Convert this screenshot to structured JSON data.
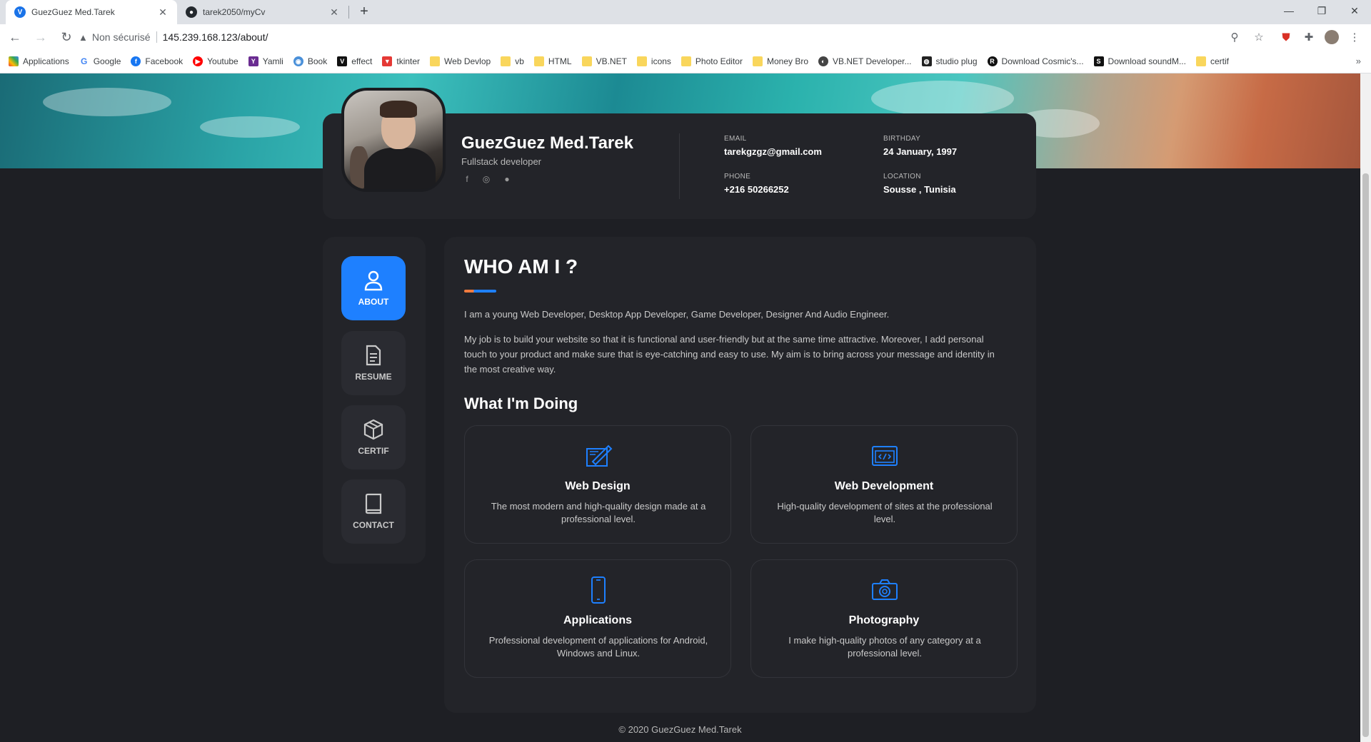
{
  "browser": {
    "tabs": [
      {
        "title": "GuezGuez Med.Tarek",
        "favicon": "V"
      },
      {
        "title": "tarek2050/myCv",
        "favicon": "github-icon"
      }
    ],
    "new_tab": "+",
    "security": "Non sécurisé",
    "url": "145.239.168.123/about/",
    "bookmarks": [
      {
        "label": "Applications",
        "icon": "apps-grid-icon"
      },
      {
        "label": "Google",
        "icon": "google-icon"
      },
      {
        "label": "Facebook",
        "icon": "facebook-icon"
      },
      {
        "label": "Youtube",
        "icon": "youtube-icon"
      },
      {
        "label": "Yamli",
        "icon": "yamli-icon"
      },
      {
        "label": "Book",
        "icon": "globe-icon"
      },
      {
        "label": "effect",
        "icon": "v-icon"
      },
      {
        "label": "tkinter",
        "icon": "vue-icon"
      },
      {
        "label": "Web Devlop",
        "icon": "folder-icon"
      },
      {
        "label": "vb",
        "icon": "folder-icon"
      },
      {
        "label": "HTML",
        "icon": "folder-icon"
      },
      {
        "label": "VB.NET",
        "icon": "folder-icon"
      },
      {
        "label": "icons",
        "icon": "folder-icon"
      },
      {
        "label": "Photo Editor",
        "icon": "folder-icon"
      },
      {
        "label": "Money Bro",
        "icon": "folder-icon"
      },
      {
        "label": "VB.NET Developer...",
        "icon": "site-icon"
      },
      {
        "label": "studio plug",
        "icon": "site-icon"
      },
      {
        "label": "Download Cosmic's...",
        "icon": "site-icon"
      },
      {
        "label": "Download soundM...",
        "icon": "site-icon"
      },
      {
        "label": "certif",
        "icon": "folder-icon"
      }
    ],
    "bookmarks_more": "»"
  },
  "profile": {
    "name": "GuezGuez Med.Tarek",
    "role": "Fullstack developer",
    "email_label": "EMAIL",
    "email": "tarekgzgz@gmail.com",
    "birthday_label": "BIRTHDAY",
    "birthday": "24 January, 1997",
    "phone_label": "PHONE",
    "phone": "+216 50266252",
    "location_label": "LOCATION",
    "location": "Sousse , Tunisia"
  },
  "nav": {
    "about": "ABOUT",
    "resume": "RESUME",
    "certif": "CERTIF",
    "contact": "CONTACT"
  },
  "about": {
    "title": "WHO AM I ?",
    "p1": "I am a young Web Developer, Desktop App Developer, Game Developer, Designer And Audio Engineer.",
    "p2": "My job is to build your website so that it is functional and user-friendly but at the same time attractive. Moreover, I add personal touch to your product and make sure that is eye-catching and easy to use. My aim is to bring across your message and identity in the most creative way.",
    "doing_title": "What I'm Doing",
    "services": [
      {
        "title": "Web Design",
        "desc": "The most modern and high-quality design made at a professional level."
      },
      {
        "title": "Web Development",
        "desc": "High-quality development of sites at the professional level."
      },
      {
        "title": "Applications",
        "desc": "Professional development of applications for Android, Windows and Linux."
      },
      {
        "title": "Photography",
        "desc": "I make high-quality photos of any category at a professional level."
      }
    ]
  },
  "footer": "© 2020 GuezGuez Med.Tarek",
  "colors": {
    "accent": "#1e80ff",
    "underline_orange": "#f07b3f",
    "background": "#1e1f24",
    "card": "#232429"
  }
}
